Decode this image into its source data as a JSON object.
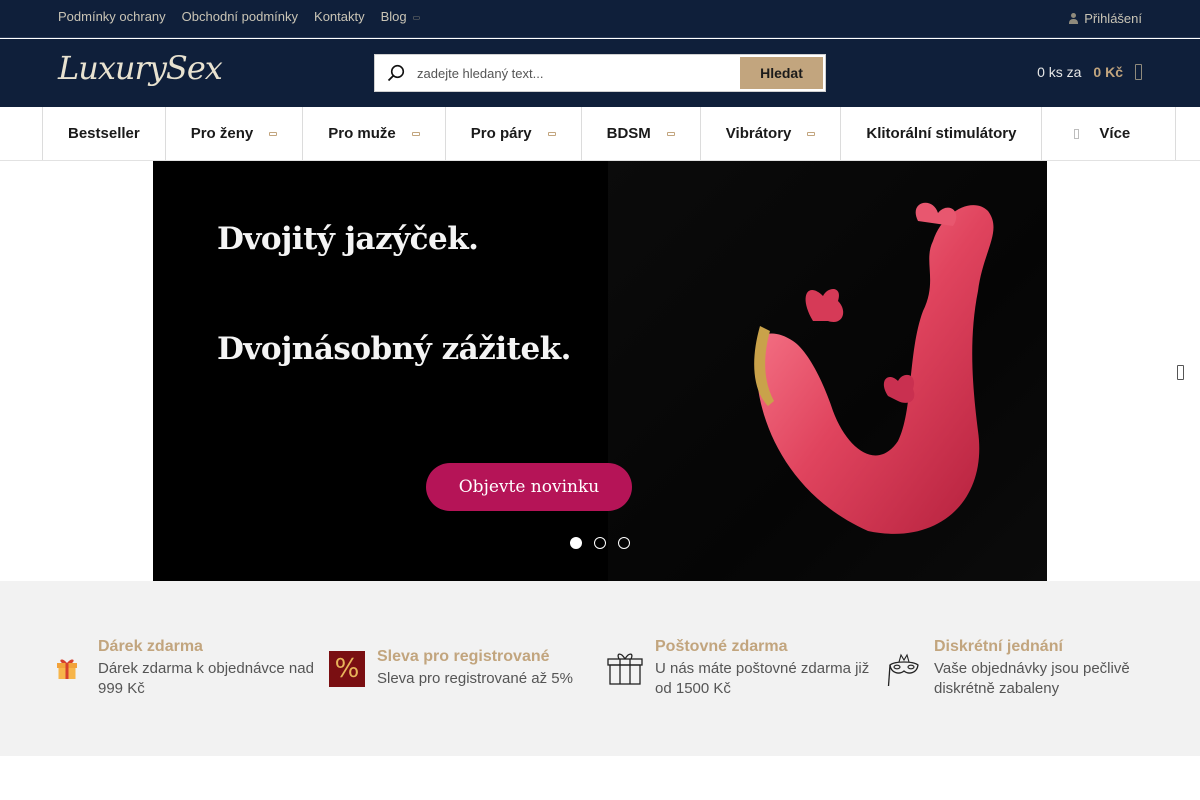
{
  "topbar": {
    "links": [
      "Podmínky ochrany",
      "Obchodní podmínky",
      "Kontakty",
      "Blog"
    ],
    "login_label": "Přihlášení"
  },
  "header": {
    "logo_text": "LuxurySex",
    "search": {
      "placeholder": "zadejte hledaný text...",
      "button_label": "Hledat"
    },
    "cart": {
      "count_label": "0 ks za",
      "price_label": "0 Kč"
    }
  },
  "nav": {
    "items": [
      "Bestseller",
      "Pro ženy",
      "Pro muže",
      "Pro páry",
      "BDSM",
      "Vibrátory",
      "Klitorální stimulátory",
      "Více"
    ]
  },
  "hero": {
    "headline_1": "Dvojitý jazýček.",
    "headline_2": "Dvojnásobný zážitek.",
    "cta_label": "Objevte novinku",
    "slide_count": 3,
    "active_slide": 1
  },
  "benefits": [
    {
      "icon": "gift-icon",
      "title": "Dárek zdarma",
      "text": "Dárek zdarma k objednávce nad 999 Kč"
    },
    {
      "icon": "percent-icon",
      "icon_text": "%",
      "title": "Sleva pro registrované",
      "text": "Sleva pro registrované až 5%"
    },
    {
      "icon": "package-icon",
      "title": "Poštovné zdarma",
      "text": "U nás máte poštovné zdarma již od 1500 Kč"
    },
    {
      "icon": "mask-icon",
      "title": "Diskrétní jednání",
      "text": "Vaše objednávky jsou pečlivě diskrétně zabaleny"
    }
  ],
  "colors": {
    "header_bg": "#0f1f3a",
    "accent_gold": "#c2a57e",
    "cta_pink": "#b51457",
    "benefits_bg": "#f2f2f2"
  }
}
